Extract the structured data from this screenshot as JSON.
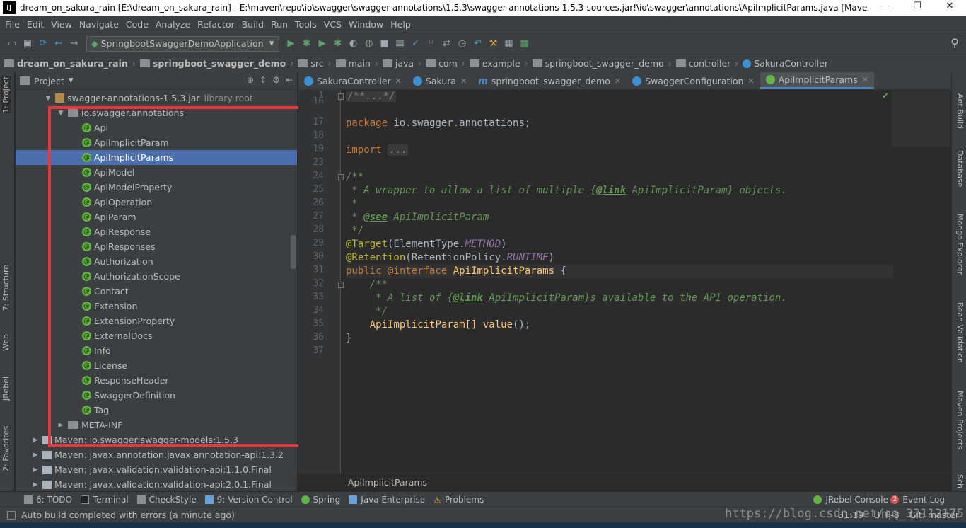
{
  "window": {
    "title": "dream_on_sakura_rain [E:\\dream_on_sakura_rain] - E:\\maven\\repo\\io\\swagger\\swagger-annotations\\1.5.3\\swagger-annotations-1.5.3-sources.jar!\\io\\swagger\\annotations\\ApiImplicitParams.java [Maven: i...",
    "logo": "IJ",
    "minimize": "—",
    "maximize": "☐",
    "close": "✕"
  },
  "menu": [
    "File",
    "Edit",
    "View",
    "Navigate",
    "Code",
    "Analyze",
    "Refactor",
    "Build",
    "Run",
    "Tools",
    "VCS",
    "Window",
    "Help"
  ],
  "toolbar": {
    "run_config": "SpringbootSwaggerDemoApplication",
    "search_icon": "search-icon"
  },
  "breadcrumbs": [
    {
      "label": "dream_on_sakura_rain",
      "bold": true
    },
    {
      "label": "springboot_swagger_demo",
      "bold": true
    },
    {
      "label": "src"
    },
    {
      "label": "main"
    },
    {
      "label": "java"
    },
    {
      "label": "com"
    },
    {
      "label": "example"
    },
    {
      "label": "springboot_swagger_demo"
    },
    {
      "label": "controller"
    },
    {
      "label": "SakuraController"
    }
  ],
  "left_tabs": {
    "project": "1: Project",
    "structure": "7: Structure",
    "web": "Web",
    "jrebel": "JRebel",
    "favorites": "2: Favorites"
  },
  "right_tabs": {
    "ant": "Ant Build",
    "database": "Database",
    "mongo": "Mongo Explorer",
    "bean": "Bean Validation",
    "maven": "Maven Projects",
    "sch": "Sch"
  },
  "project": {
    "header": "Project",
    "tree": [
      {
        "label": "swagger-annotations-1.5.3.jar",
        "note": "library root",
        "indent": 40,
        "arrow": "▼",
        "icon": "jar"
      },
      {
        "label": "io.swagger.annotations",
        "indent": 58,
        "arrow": "▼",
        "icon": "folder"
      },
      {
        "label": "Api",
        "indent": 78,
        "icon": "annotation"
      },
      {
        "label": "ApiImplicitParam",
        "indent": 78,
        "icon": "annotation"
      },
      {
        "label": "ApiImplicitParams",
        "indent": 78,
        "icon": "annotation",
        "selected": true
      },
      {
        "label": "ApiModel",
        "indent": 78,
        "icon": "annotation"
      },
      {
        "label": "ApiModelProperty",
        "indent": 78,
        "icon": "annotation"
      },
      {
        "label": "ApiOperation",
        "indent": 78,
        "icon": "annotation"
      },
      {
        "label": "ApiParam",
        "indent": 78,
        "icon": "annotation"
      },
      {
        "label": "ApiResponse",
        "indent": 78,
        "icon": "annotation"
      },
      {
        "label": "ApiResponses",
        "indent": 78,
        "icon": "annotation"
      },
      {
        "label": "Authorization",
        "indent": 78,
        "icon": "annotation"
      },
      {
        "label": "AuthorizationScope",
        "indent": 78,
        "icon": "annotation"
      },
      {
        "label": "Contact",
        "indent": 78,
        "icon": "annotation"
      },
      {
        "label": "Extension",
        "indent": 78,
        "icon": "annotation"
      },
      {
        "label": "ExtensionProperty",
        "indent": 78,
        "icon": "annotation"
      },
      {
        "label": "ExternalDocs",
        "indent": 78,
        "icon": "annotation"
      },
      {
        "label": "Info",
        "indent": 78,
        "icon": "annotation"
      },
      {
        "label": "License",
        "indent": 78,
        "icon": "annotation"
      },
      {
        "label": "ResponseHeader",
        "indent": 78,
        "icon": "annotation"
      },
      {
        "label": "SwaggerDefinition",
        "indent": 78,
        "icon": "annotation"
      },
      {
        "label": "Tag",
        "indent": 78,
        "icon": "annotation"
      },
      {
        "label": "META-INF",
        "indent": 58,
        "arrow": "▶",
        "icon": "folder"
      },
      {
        "label": "Maven: io.swagger:swagger-models:1.5.3",
        "indent": 22,
        "arrow": "▶",
        "icon": "maven"
      },
      {
        "label": "Maven: javax.annotation:javax.annotation-api:1.3.2",
        "indent": 22,
        "arrow": "▶",
        "icon": "maven"
      },
      {
        "label": "Maven: javax.validation:validation-api:1.1.0.Final",
        "indent": 22,
        "arrow": "▶",
        "icon": "maven"
      },
      {
        "label": "Maven: javax.validation:validation-api:2.0.1.Final",
        "indent": 22,
        "arrow": "▶",
        "icon": "maven"
      }
    ]
  },
  "tabs": [
    {
      "label": "SakuraController",
      "icon": "class"
    },
    {
      "label": "Sakura",
      "icon": "class"
    },
    {
      "label": "springboot_swagger_demo",
      "icon": "maven"
    },
    {
      "label": "SwaggerConfiguration",
      "icon": "class"
    },
    {
      "label": "ApiImplicitParams",
      "icon": "annotation",
      "active": true
    }
  ],
  "line_numbers": [
    "1",
    "16",
    "17",
    "18",
    "19",
    "23",
    "24",
    "25",
    "26",
    "27",
    "28",
    "29",
    "30",
    "31",
    "32",
    "33",
    "34",
    "35",
    "36",
    "37"
  ],
  "code": {
    "l1": "/**...*/",
    "l17a": "package",
    "l17b": " io.swagger.annotations;",
    "l19a": "import",
    "l19b": "...",
    "l24": "/**",
    "l25a": " * A wrapper to allow a list of multiple {",
    "l25b": "@link",
    "l25c": " ApiImplicitParam",
    "l25d": "} objects.",
    "l26": " *",
    "l27a": " * ",
    "l27b": "@see",
    "l27c": " ApiImplicitParam",
    "l28": " */",
    "l29a": "@Target",
    "l29b": "(ElementType.",
    "l29c": "METHOD",
    "l29d": ")",
    "l30a": "@Retention",
    "l30b": "(RetentionPolicy.",
    "l30c": "RUNTIME",
    "l30d": ")",
    "l31a": "public",
    "l31b": " @interface ",
    "l31c": "ApiImplicitParams",
    "l31d": " {",
    "l32": "    /**",
    "l33a": "     * A list of {",
    "l33b": "@link",
    "l33c": " ApiImplicitParam",
    "l33d": "}s available to the API operation.",
    "l34": "     */",
    "l35a": "    ApiImplicitParam[] ",
    "l35b": "value",
    "l35c": "();",
    "l36": "}"
  },
  "editor_footer": "ApiImplicitParams",
  "tool_windows": {
    "todo": "6: TODO",
    "terminal": "Terminal",
    "checkstyle": "CheckStyle",
    "vcs": "9: Version Control",
    "spring": "Spring",
    "javaee": "Java Enterprise",
    "problems": "Problems",
    "jrebel_console": "JRebel Console",
    "event_log": "Event Log",
    "event_count": "2"
  },
  "status": {
    "message": "Auto build completed with errors (a minute ago)",
    "position": "31:19",
    "encoding": "UTF-8",
    "git": "Git: master"
  },
  "watermark": "https://blog.csdn.net/qq_32112175"
}
